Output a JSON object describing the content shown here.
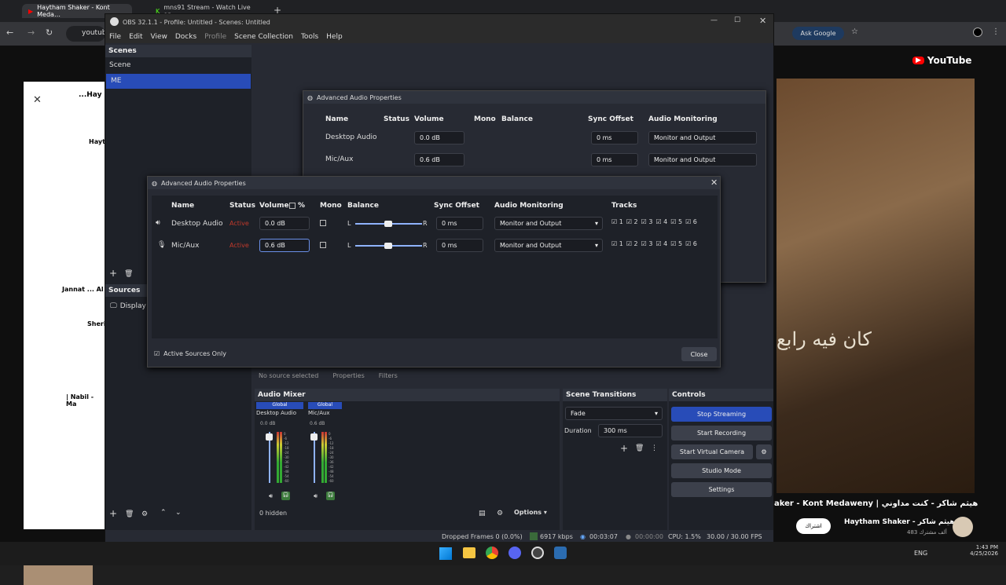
{
  "browser": {
    "tabs": [
      "Haytham Shaker - Kont Meda…",
      "mns91 Stream - Watch Live on…"
    ],
    "address": "youtub",
    "ask_google": "Ask Google",
    "youtube_logo": "YouTube",
    "video_title": "aker - Kont Medaweny | هيثم شاكر - كنت مداوني",
    "channel": "Haytham Shaker - هيثم شاكر",
    "subscribers": "483 ألف مشترك",
    "subscribe": "اشتراك",
    "overlay_lyric": "كان فيه رابع",
    "left_titles": [
      "...Hay",
      "Hayt",
      "Jannat ... Al",
      "Sheri",
      "| Nabil - Ma"
    ]
  },
  "obs": {
    "title": "OBS 32.1.1 - Profile: Untitled - Scenes: Untitled",
    "menu": [
      "File",
      "Edit",
      "View",
      "Docks",
      "Profile",
      "Scene Collection",
      "Tools",
      "Help"
    ],
    "scenes_header": "Scenes",
    "scenes": [
      "Scene",
      "ME"
    ],
    "sources_header": "Sources",
    "sources": [
      "Display"
    ],
    "no_source": "No source selected",
    "properties": "Properties",
    "filters": "Filters",
    "audio_mixer": {
      "header": "Audio Mixer",
      "channels": [
        {
          "tag": "Global",
          "name": "Desktop Audio",
          "db": "0.0 dB"
        },
        {
          "tag": "Global",
          "name": "Mic/Aux",
          "db": "0.6 dB"
        }
      ],
      "scale": [
        "0",
        "-6",
        "-12",
        "-18",
        "-24",
        "-30",
        "-36",
        "-42",
        "-48",
        "-54",
        "-60"
      ],
      "hidden": "0 hidden",
      "options": "Options"
    },
    "scene_transitions": {
      "header": "Scene Transitions",
      "transition": "Fade",
      "duration_label": "Duration",
      "duration": "300 ms"
    },
    "controls": {
      "header": "Controls",
      "buttons": [
        "Stop Streaming",
        "Start Recording",
        "Start Virtual Camera",
        "Studio Mode",
        "Settings"
      ]
    },
    "status": {
      "dropped": "Dropped Frames 0 (0.0%)",
      "kbps": "6917 kbps",
      "stream_time": "00:03:07",
      "rec_time": "00:00:00",
      "cpu": "CPU: 1.5%",
      "fps": "30.00 / 30.00 FPS"
    }
  },
  "adv_audio": {
    "title": "Advanced Audio Properties",
    "columns": [
      "Name",
      "Status",
      "Volume",
      "%",
      "Mono",
      "Balance",
      "Sync Offset",
      "Audio Monitoring",
      "Tracks"
    ],
    "rows": [
      {
        "name": "Desktop Audio",
        "status": "Active",
        "volume": "0.0 dB",
        "sync": "0 ms",
        "monitoring": "Monitor and Output"
      },
      {
        "name": "Mic/Aux",
        "status": "Active",
        "volume": "0.6 dB",
        "sync": "0 ms",
        "monitoring": "Monitor and Output"
      }
    ],
    "tracks": [
      "1",
      "2",
      "3",
      "4",
      "5",
      "6"
    ],
    "balance_l": "L",
    "balance_r": "R",
    "active_only": "Active Sources Only",
    "close": "Close"
  },
  "taskbar": {
    "lang": "ENG",
    "time": "1:43 PM",
    "date": "4/25/2026"
  }
}
